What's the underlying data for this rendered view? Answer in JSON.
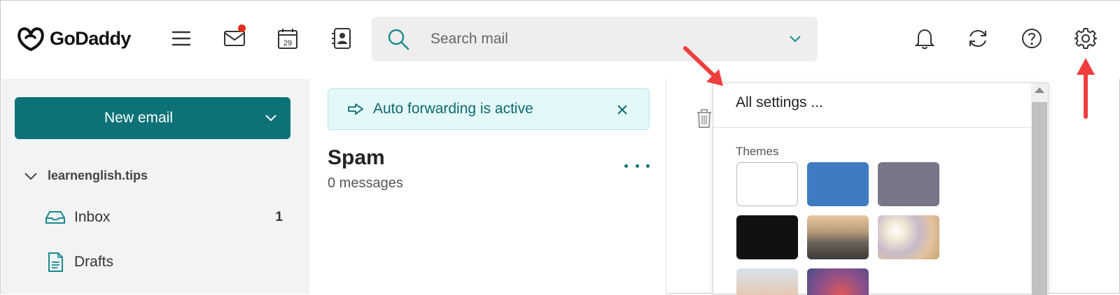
{
  "header": {
    "brand": "GoDaddy",
    "icons": [
      "menu-icon",
      "mail-icon",
      "calendar-icon",
      "contacts-icon",
      "bell-icon",
      "sync-icon",
      "help-icon",
      "gear-icon"
    ],
    "calendar_day": "29",
    "mail_badge_color": "#e0301e",
    "search": {
      "placeholder": "Search mail"
    }
  },
  "sidebar": {
    "new_email_label": "New email",
    "account": "learnenglish.tips",
    "folders": [
      {
        "label": "Inbox",
        "count": "1",
        "icon": "inbox-icon"
      },
      {
        "label": "Drafts",
        "count": "",
        "icon": "drafts-icon"
      }
    ]
  },
  "list": {
    "banner_text": "Auto forwarding is active",
    "folder_title": "Spam",
    "folder_subtitle": "0 messages"
  },
  "settings_menu": {
    "all_settings": "All settings ...",
    "themes_label": "Themes",
    "themes": [
      {
        "name": "white",
        "color": "#ffffff"
      },
      {
        "name": "blue",
        "color": "#3f7bc1"
      },
      {
        "name": "slate",
        "color": "#777789"
      },
      {
        "name": "black",
        "color": "#111111"
      },
      {
        "name": "mountains",
        "color": "#8a7f70"
      },
      {
        "name": "beach",
        "color": "#d9b98f"
      },
      {
        "name": "city",
        "color": "#c9a58c"
      },
      {
        "name": "nebula",
        "color": "#8a4f8a"
      }
    ]
  },
  "colors": {
    "accent": "#0c7277",
    "annotation_arrow": "#ef3e3e"
  }
}
